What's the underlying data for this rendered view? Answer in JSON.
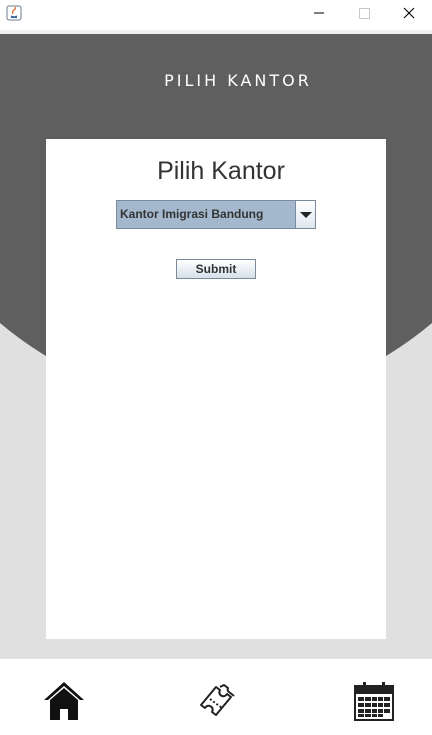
{
  "header": {
    "title": "PILIH KANTOR"
  },
  "card": {
    "title": "Pilih Kantor",
    "office_select": {
      "selected": "Kantor Imigrasi Bandung"
    },
    "submit_label": "Submit"
  },
  "window_controls": {
    "icons": [
      "java-app-icon",
      "minimize-icon",
      "maximize-icon",
      "close-icon"
    ]
  },
  "nav": {
    "icons": [
      "home-icon",
      "ticket-icon",
      "calendar-icon"
    ]
  },
  "colors": {
    "header_circle": "#5f5f5f",
    "background": "#e0e0e0",
    "combo": "#a3b8cc"
  }
}
